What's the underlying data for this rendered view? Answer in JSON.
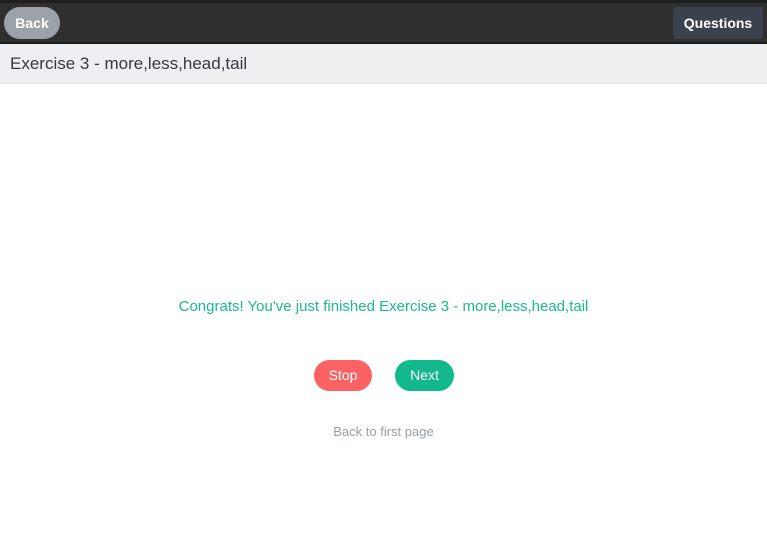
{
  "header": {
    "back_label": "Back",
    "questions_label": "Questions"
  },
  "title_bar": {
    "title": "Exercise 3 - more,less,head,tail"
  },
  "main": {
    "congrats_message": "Congrats! You've just finished Exercise 3 - more,less,head,tail",
    "stop_label": "Stop",
    "next_label": "Next",
    "back_to_first_label": "Back to first page"
  },
  "colors": {
    "topbar": "#2f2f2f",
    "back_button": "#9da2a8",
    "questions_button": "#3a434d",
    "congrats_text": "#1db88e",
    "stop_button": "#fa6263",
    "next_button": "#12b98c",
    "link_text": "#999fa5"
  }
}
